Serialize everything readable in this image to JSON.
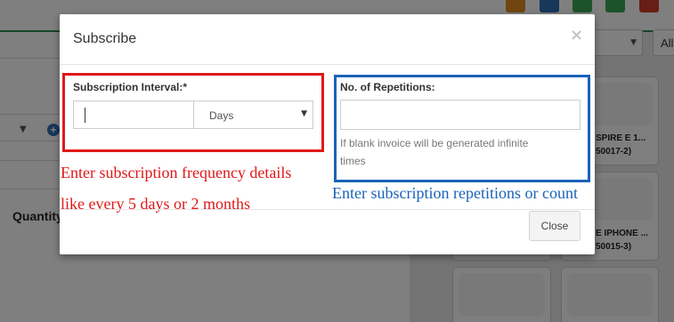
{
  "background": {
    "quantity_label": "Quantity",
    "filter_all_label": "All",
    "products": [
      {
        "line1": "SPIRE E 1...",
        "line2": "50017-2)"
      },
      {
        "line1": "E IPHONE ...",
        "line2": "50015-3)"
      }
    ],
    "top_icons": [
      {
        "name": "power-icon",
        "color": "#e08a1e"
      },
      {
        "name": "window-icon",
        "color": "#2f6fb6"
      },
      {
        "name": "grid-icon",
        "color": "#3aa655"
      },
      {
        "name": "inbox-icon",
        "color": "#3aa655"
      },
      {
        "name": "close-icon",
        "color": "#d03a2a"
      }
    ]
  },
  "modal": {
    "title": "Subscribe",
    "close_symbol": "×",
    "interval": {
      "label": "Subscription Interval:*",
      "value": "",
      "unit_selected": "Days"
    },
    "repetitions": {
      "label": "No. of Repetitions:",
      "value": "",
      "help_line1": "If blank invoice will be generated infinite",
      "help_line2": "times"
    },
    "close_button_label": "Close"
  },
  "annotations": {
    "red_line1": "Enter subscription frequency details",
    "red_line2": "like every 5 days or 2 months",
    "blue": "Enter subscription repetitions or count",
    "red_color": "#e01818",
    "blue_color": "#1a63b8"
  }
}
